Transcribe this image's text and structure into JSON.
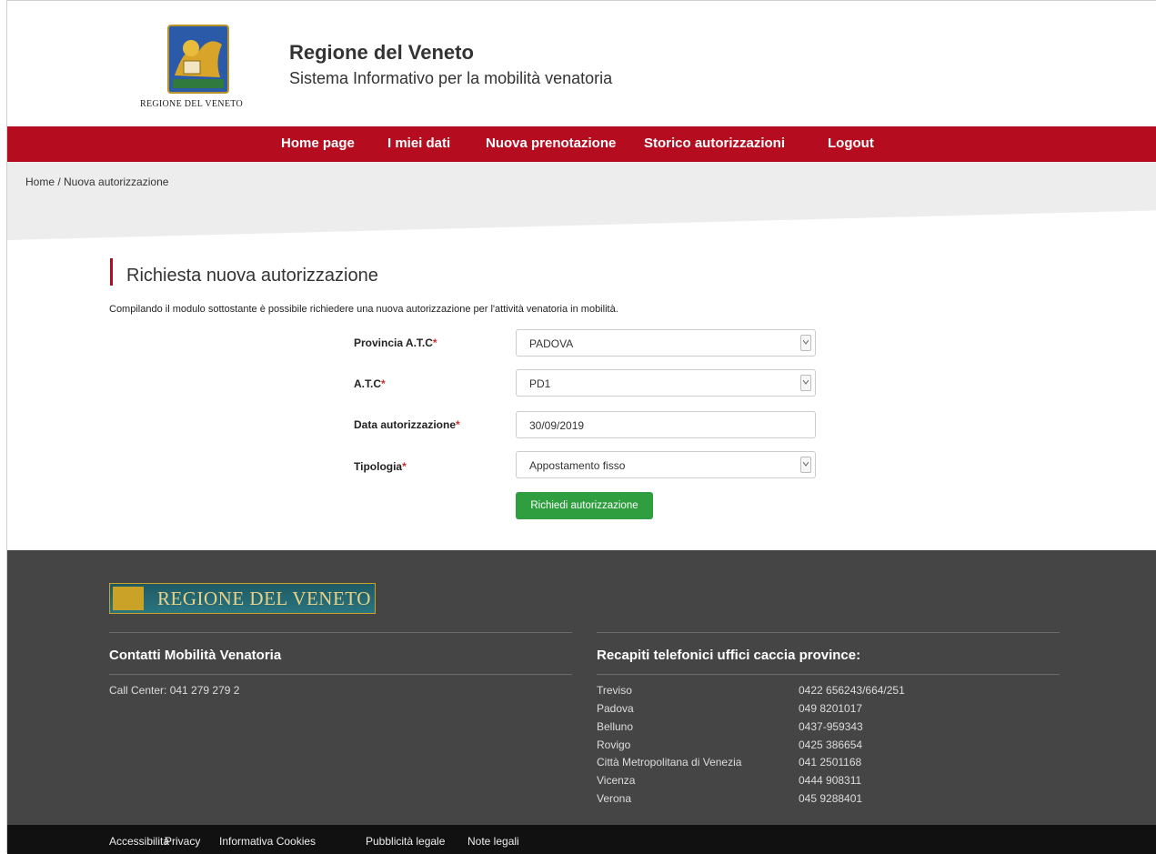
{
  "header": {
    "logo_caption": "REGIONE DEL VENETO",
    "title": "Regione del Veneto",
    "subtitle": "Sistema Informativo per la mobilità venatoria"
  },
  "nav": [
    "Home page",
    "I miei dati",
    "Nuova prenotazione",
    "Storico autorizzazioni",
    "Logout"
  ],
  "breadcrumb": "Home / Nuova autorizzazione",
  "main": {
    "heading": "Richiesta nuova autorizzazione",
    "intro": "Compilando il modulo sottostante è possibile richiedere una nuova autorizzazione per l'attività venatoria in mobilità.",
    "fields": [
      {
        "label": "Provincia A.T.C",
        "value": "PADOVA"
      },
      {
        "label": "A.T.C",
        "value": "PD1"
      },
      {
        "label": "Data autorizzazione",
        "value": "30/09/2019"
      },
      {
        "label": "Tipologia",
        "value": "Appostamento fisso"
      }
    ],
    "required_mark": "*",
    "submit": "Richiedi autorizzazione"
  },
  "footer": {
    "logo_text": "REGIONE DEL VENETO",
    "contacts_title": "Contatti Mobilità Venatoria",
    "call_center": "Call Center: 041 279 279 2",
    "phones_title": "Recapiti telefonici uffici caccia province:",
    "phones": [
      {
        "name": "Treviso",
        "phone": "0422 656243/664/251"
      },
      {
        "name": "Padova",
        "phone": "049 8201017"
      },
      {
        "name": "Belluno",
        "phone": "0437-959343"
      },
      {
        "name": "Rovigo",
        "phone": "0425 386654"
      },
      {
        "name": "Città Metropolitana di Venezia",
        "phone": "041 2501168"
      },
      {
        "name": "Vicenza",
        "phone": "0444 908311"
      },
      {
        "name": "Verona",
        "phone": "045 9288401"
      }
    ]
  },
  "legal": [
    "Accessibilità",
    "Privacy",
    "Informativa Cookies",
    "Pubblicità legale",
    "Note legali"
  ],
  "colors": {
    "brand_red": "#b50d1f",
    "button_green": "#2e9e3f",
    "footer_bg": "#454545"
  }
}
